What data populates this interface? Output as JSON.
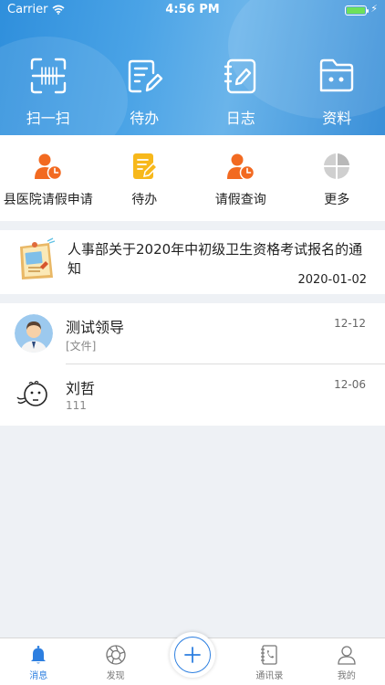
{
  "status": {
    "carrier": "Carrier",
    "time": "4:56 PM"
  },
  "top_actions": [
    {
      "label": "扫一扫",
      "icon": "scan-icon"
    },
    {
      "label": "待办",
      "icon": "edit-pad-icon"
    },
    {
      "label": "日志",
      "icon": "journal-icon"
    },
    {
      "label": "资料",
      "icon": "folder-icon"
    }
  ],
  "quick_actions": [
    {
      "label": "县医院请假申请",
      "icon": "person-clock-icon"
    },
    {
      "label": "待办",
      "icon": "note-pen-icon"
    },
    {
      "label": "请假查询",
      "icon": "person-clock-icon"
    },
    {
      "label": "更多",
      "icon": "grid-more-icon"
    }
  ],
  "notice": {
    "title": "人事部关于2020年中初级卫生资格考试报名的通知",
    "date": "2020-01-02"
  },
  "messages": [
    {
      "name": "测试领导",
      "preview": "[文件]",
      "time": "12-12"
    },
    {
      "name": "刘哲",
      "preview": "111",
      "time": "12-06"
    }
  ],
  "tabs": [
    {
      "label": "消息",
      "icon": "bell-icon",
      "active": true
    },
    {
      "label": "发现",
      "icon": "aperture-icon"
    },
    {
      "label": "通讯录",
      "icon": "contact-book-icon"
    },
    {
      "label": "我的",
      "icon": "user-icon"
    }
  ],
  "colors": {
    "accent": "#2d7fe0",
    "quick_orange": "#f26a21",
    "quick_yellow": "#f7b81b"
  }
}
